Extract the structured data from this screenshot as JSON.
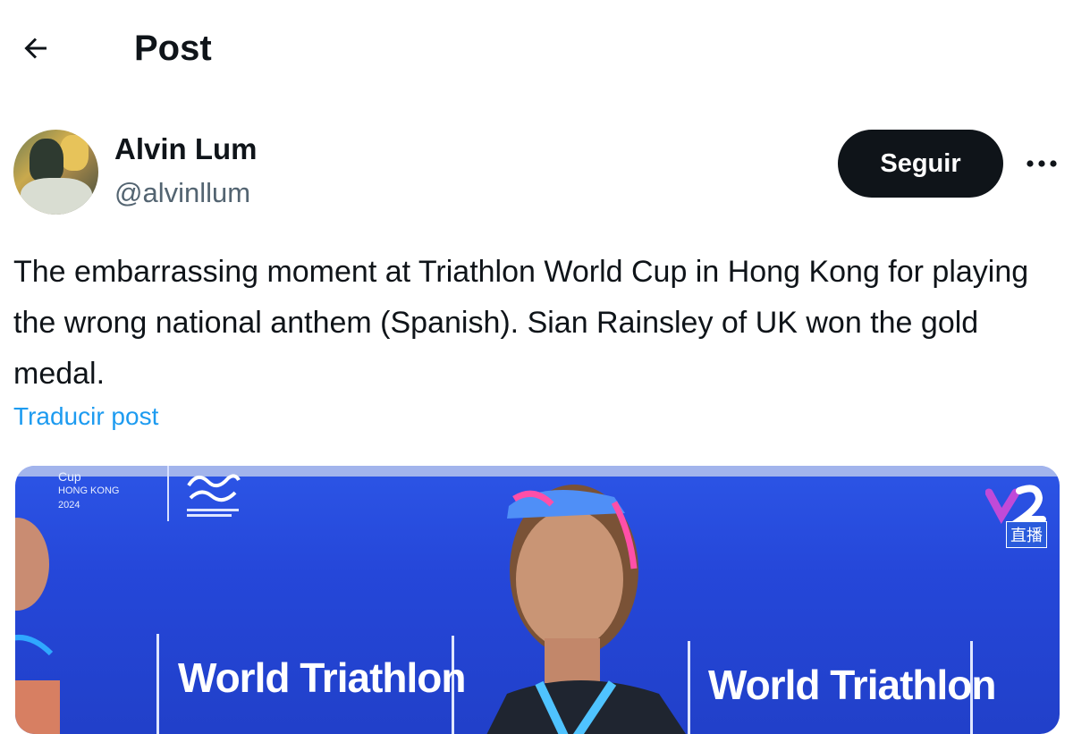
{
  "header": {
    "title": "Post",
    "back_icon": "arrow-left-icon"
  },
  "author": {
    "display_name": "Alvin Lum",
    "handle": "@alvinllum",
    "follow_label": "Seguir",
    "more_icon": "more-horizontal-icon"
  },
  "post": {
    "text": "The embarrassing moment at Triathlon World Cup in Hong Kong for playing the wrong national anthem (Spanish). Sian Rainsley of UK won the gold medal.",
    "translate_label": "Traducir post"
  },
  "media": {
    "event_line1": "Cup",
    "event_line2": "HONG KONG",
    "event_line3": "2024",
    "banner_text_1": "World Triathlon",
    "banner_text_2": "World Triathlon",
    "tv_label": "直播"
  },
  "colors": {
    "accent": "#1d9bf0",
    "text": "#0f1419",
    "muted": "#536471",
    "button": "#0f1419"
  }
}
